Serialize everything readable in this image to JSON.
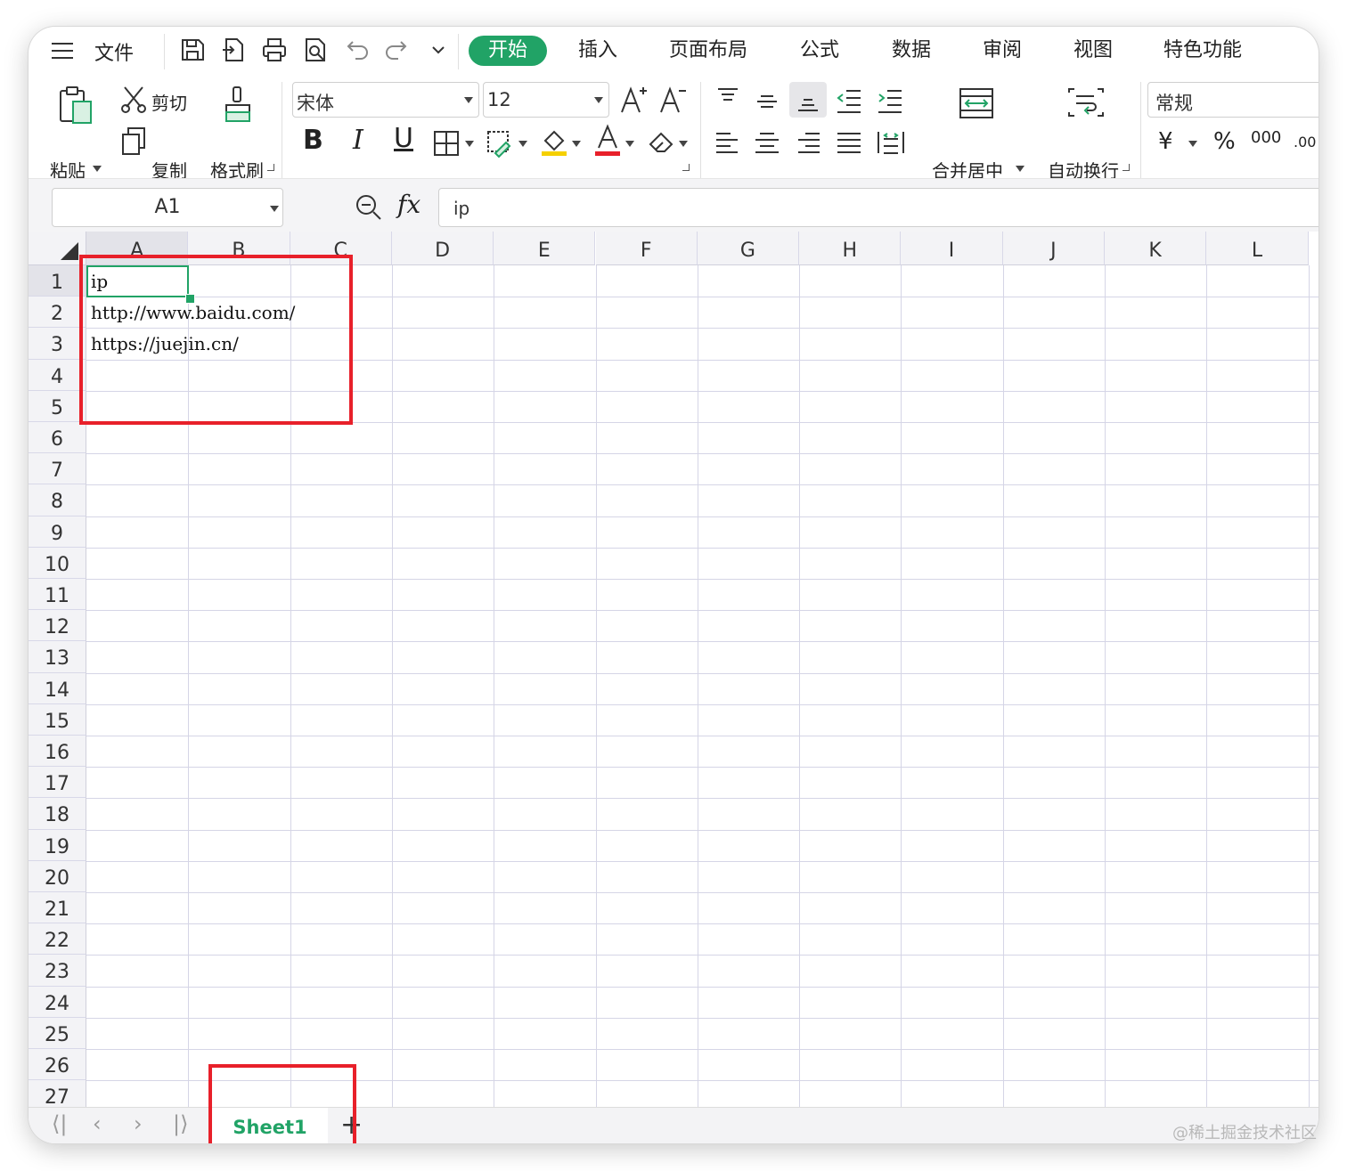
{
  "menubar": {
    "file_label": "文件",
    "tabs": [
      {
        "label": "开始",
        "active": true
      },
      {
        "label": "插入"
      },
      {
        "label": "页面布局"
      },
      {
        "label": "公式"
      },
      {
        "label": "数据"
      },
      {
        "label": "审阅"
      },
      {
        "label": "视图"
      },
      {
        "label": "特色功能"
      }
    ]
  },
  "ribbon": {
    "paste_label": "粘贴",
    "cut_label": "剪切",
    "copy_label": "复制",
    "format_painter_label": "格式刷",
    "font_name": "宋体",
    "font_size": "12",
    "bold": "B",
    "italic": "I",
    "underline": "U",
    "merge_label": "合并居中",
    "wrap_label": "自动换行",
    "number_format": "常规",
    "currency_symbol": "¥",
    "percent_symbol": "%",
    "thousands_symbol": "000",
    "decimal_symbol": ".00"
  },
  "formula_bar": {
    "name_box": "A1",
    "fx_label": "fx",
    "content": "ip"
  },
  "sheet": {
    "columns": [
      "A",
      "B",
      "C",
      "D",
      "E",
      "F",
      "G",
      "H",
      "I",
      "J",
      "K",
      "L"
    ],
    "selected_column": "A",
    "rows": [
      "1",
      "2",
      "3",
      "4",
      "5",
      "6",
      "7",
      "8",
      "9",
      "10",
      "11",
      "12",
      "13",
      "14",
      "15",
      "16",
      "17",
      "18",
      "19",
      "20",
      "21",
      "22",
      "23",
      "24",
      "25",
      "26",
      "27"
    ],
    "selected_row": "1",
    "cells": {
      "A1": "ip",
      "A2": "http://www.baidu.com/",
      "A3": "https://juejin.cn/"
    }
  },
  "sheetbar": {
    "tabs": [
      "Sheet1"
    ],
    "add_label": "+"
  },
  "watermark": "@稀土掘金技术社区",
  "colors": {
    "accent": "#21a366",
    "highlight_box": "#e8202a"
  }
}
